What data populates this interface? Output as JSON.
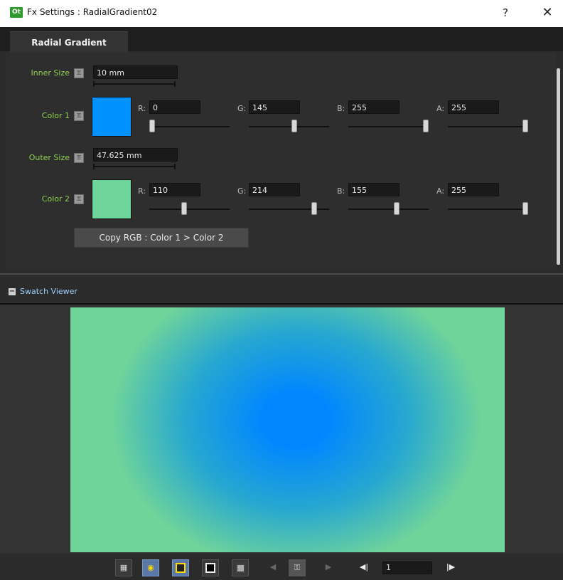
{
  "window": {
    "icon_text": "Ot",
    "title": "Fx Settings : RadialGradient02",
    "help": "?",
    "close": "✕"
  },
  "tab": {
    "label": "Radial Gradient"
  },
  "params": {
    "inner_size": {
      "label": "Inner Size",
      "value": "10 mm"
    },
    "color1": {
      "label": "Color 1",
      "swatch": "#0091ff",
      "r_label": "R:",
      "r": "0",
      "g_label": "G:",
      "g": "145",
      "b_label": "B:",
      "b": "255",
      "a_label": "A:",
      "a": "255",
      "levels": {
        "r": 0,
        "g": 145,
        "b": 255,
        "a": 255,
        "max": 255
      }
    },
    "outer_size": {
      "label": "Outer Size",
      "value": "47.625 mm"
    },
    "color2": {
      "label": "Color 2",
      "swatch": "#6ed69b",
      "r_label": "R:",
      "r": "110",
      "g_label": "G:",
      "g": "214",
      "b_label": "B:",
      "b": "155",
      "a_label": "A:",
      "a": "255",
      "levels": {
        "r": 110,
        "g": 214,
        "b": 155,
        "a": 255,
        "max": 255
      }
    },
    "copy_button": "Copy RGB : Color 1 > Color 2"
  },
  "viewer": {
    "collapse": "−",
    "title": "Swatch Viewer",
    "inner_color": "#0087ff",
    "outer_color": "#6fd49a"
  },
  "toolbar": {
    "frame_value": "1",
    "buttons": [
      "checker-icon",
      "eye-icon",
      "camera-stand-icon",
      "black-bg-icon",
      "white-bg-icon",
      "prev-icon",
      "lock-icon",
      "next-icon",
      "first-frame-icon",
      "last-frame-icon"
    ]
  }
}
